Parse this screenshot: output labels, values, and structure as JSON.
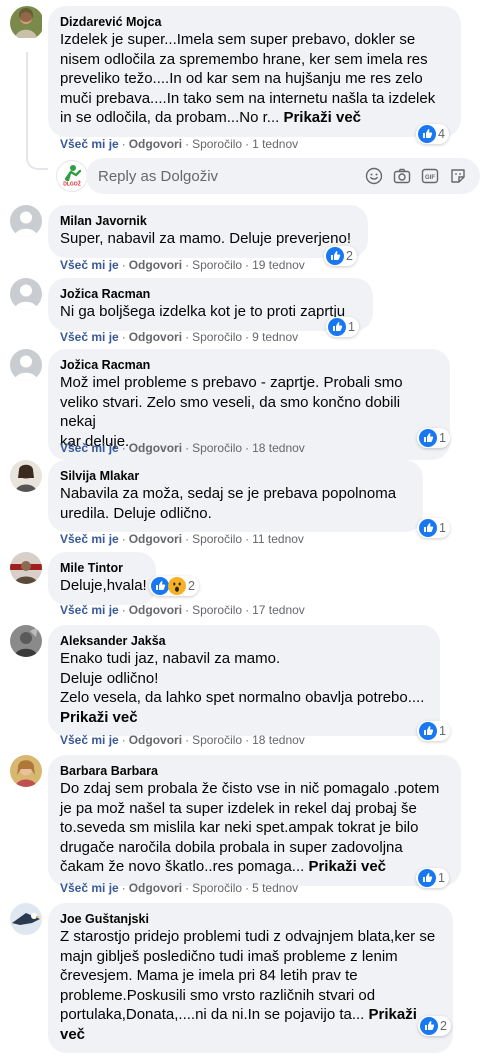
{
  "actions": {
    "like": "Všeč mi je",
    "reply": "Odgovori",
    "message": "Sporočilo",
    "dot": "·",
    "more": "Prikaži več"
  },
  "reply_box": {
    "placeholder": "Reply as Dolgoživ",
    "icons": [
      "smiley-icon",
      "camera-icon",
      "gif-icon",
      "sticker-icon"
    ]
  },
  "colors": {
    "bubble": "#f0f2f5",
    "link": "#385898",
    "meta": "#65676b",
    "like_blue": "#1877f2"
  },
  "comments": [
    {
      "author": "Dizdarević Mojca",
      "text": "Izdelek je super...Imela sem super prebavo, dokler se\nnisem odločila za spremembo hrane, ker sem imela res\npreveliko težo....In od kar sem na hujšanju me res zelo\nmuči prebava....In tako sem na internetu našla ta izdelek\nin se odločila, da probam...No r...",
      "has_more": true,
      "time": "1 tednov",
      "reactions": [
        "like"
      ],
      "reaction_count": "4"
    },
    {
      "author": "Milan Javornik",
      "text": "Super, nabavil za mamo. Deluje preverjeno!",
      "time": "19 tednov",
      "reactions": [
        "like"
      ],
      "reaction_count": "2"
    },
    {
      "author": "Jožica Racman",
      "text": "Ni ga boljšega izdelka kot je to proti zaprtju",
      "time": "9 tednov",
      "reactions": [
        "like"
      ],
      "reaction_count": "1"
    },
    {
      "author": "Jožica Racman",
      "text": "Mož imel probleme s prebavo - zaprtje. Probali smo\nveliko stvari. Zelo smo veseli, da smo končno dobili nekaj\nkar deluje.",
      "time": "18 tednov",
      "reactions": [
        "like"
      ],
      "reaction_count": "1"
    },
    {
      "author": "Silvija Mlakar",
      "text": "Nabavila za moža, sedaj se je prebava popolnoma\nuredila. Deluje odlično.",
      "time": "11 tednov",
      "reactions": [
        "like"
      ],
      "reaction_count": "1"
    },
    {
      "author": "Mile Tintor",
      "text": "Deluje,hvala!",
      "time": "17 tednov",
      "reactions": [
        "like",
        "wow"
      ],
      "reaction_count": "2"
    },
    {
      "author": "Aleksander Jakša",
      "text": "Enako tudi jaz, nabavil za mamo.\nDeluje odlično!\nZelo vesela, da lahko spet normalno obavlja potrebo....",
      "has_more": true,
      "time": "18 tednov",
      "reactions": [
        "like"
      ],
      "reaction_count": "1"
    },
    {
      "author": "Barbara Barbara",
      "text": "Do zdaj sem probala že čisto vse in nič pomagalo .potem\nje pa mož našel ta super izdelek in rekel daj probaj še\nto.seveda sm mislila kar neki spet.ampak tokrat je bilo\ndrugače naročila dobila probala in super zadovoljna\nčakam že novo škatlo..res pomaga...",
      "has_more": true,
      "time": "5 tednov",
      "reactions": [
        "like"
      ],
      "reaction_count": "1"
    },
    {
      "author": "Joe Guštanjski",
      "text": "Z starostjo pridejo problemi tudi z odvajnjem blata,ker se\nmajn giblješ posledično tudi imaš probleme z lenim\nčrevesjem. Mama je imela pri 84 letih prav te\nprobleme.Poskusili smo vrsto različnih stvari od\nportulaka,Donata,....ni da ni.In se pojavijo ta...",
      "has_more": true,
      "time": "",
      "reactions": [
        "like"
      ],
      "reaction_count": "2"
    }
  ]
}
